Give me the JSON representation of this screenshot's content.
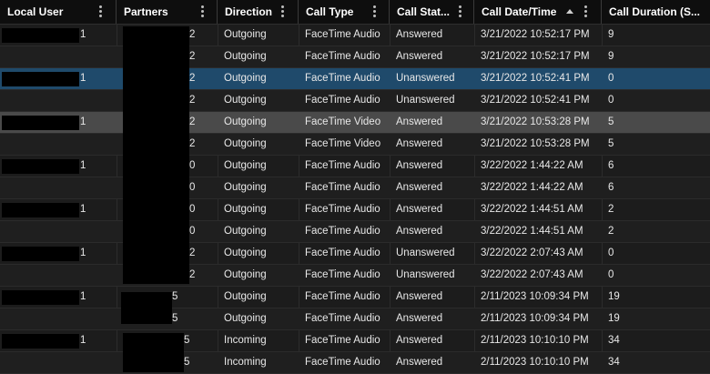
{
  "columns": [
    {
      "label": "Local User"
    },
    {
      "label": "Partners"
    },
    {
      "label": "Direction"
    },
    {
      "label": "Call Type"
    },
    {
      "label": "Call Stat..."
    },
    {
      "label": "Call Date/Time"
    },
    {
      "label": "Call Duration (S..."
    }
  ],
  "sort": {
    "column": "Call Date/Time",
    "direction": "ascending"
  },
  "colors": {
    "header_bg": "#0e0e0e",
    "row_bg": "#1c1c1c",
    "selected_row": "#1f4a6b",
    "hover_row": "#4a4a4a",
    "text": "#e8e8e8"
  },
  "rows": [
    {
      "user": "1",
      "partners": "2",
      "direction": "Outgoing",
      "type": "FaceTime Audio",
      "status": "Answered",
      "datetime": "3/21/2022 10:52:17 PM",
      "duration": "9"
    },
    {
      "user": "",
      "partners": "2",
      "direction": "Outgoing",
      "type": "FaceTime Audio",
      "status": "Answered",
      "datetime": "3/21/2022 10:52:17 PM",
      "duration": "9"
    },
    {
      "user": "1",
      "partners": "2",
      "direction": "Outgoing",
      "type": "FaceTime Audio",
      "status": "Unanswered",
      "datetime": "3/21/2022 10:52:41 PM",
      "duration": "0"
    },
    {
      "user": "",
      "partners": "2",
      "direction": "Outgoing",
      "type": "FaceTime Audio",
      "status": "Unanswered",
      "datetime": "3/21/2022 10:52:41 PM",
      "duration": "0"
    },
    {
      "user": "1",
      "partners": "2",
      "direction": "Outgoing",
      "type": "FaceTime Video",
      "status": "Answered",
      "datetime": "3/21/2022 10:53:28 PM",
      "duration": "5"
    },
    {
      "user": "",
      "partners": "2",
      "direction": "Outgoing",
      "type": "FaceTime Video",
      "status": "Answered",
      "datetime": "3/21/2022 10:53:28 PM",
      "duration": "5"
    },
    {
      "user": "1",
      "partners": "0",
      "direction": "Outgoing",
      "type": "FaceTime Audio",
      "status": "Answered",
      "datetime": "3/22/2022 1:44:22 AM",
      "duration": "6"
    },
    {
      "user": "",
      "partners": "0",
      "direction": "Outgoing",
      "type": "FaceTime Audio",
      "status": "Answered",
      "datetime": "3/22/2022 1:44:22 AM",
      "duration": "6"
    },
    {
      "user": "1",
      "partners": "0",
      "direction": "Outgoing",
      "type": "FaceTime Audio",
      "status": "Answered",
      "datetime": "3/22/2022 1:44:51 AM",
      "duration": "2"
    },
    {
      "user": "",
      "partners": "0",
      "direction": "Outgoing",
      "type": "FaceTime Audio",
      "status": "Answered",
      "datetime": "3/22/2022 1:44:51 AM",
      "duration": "2"
    },
    {
      "user": "1",
      "partners": "2",
      "direction": "Outgoing",
      "type": "FaceTime Audio",
      "status": "Unanswered",
      "datetime": "3/22/2022 2:07:43 AM",
      "duration": "0"
    },
    {
      "user": "",
      "partners": "2",
      "direction": "Outgoing",
      "type": "FaceTime Audio",
      "status": "Unanswered",
      "datetime": "3/22/2022 2:07:43 AM",
      "duration": "0"
    },
    {
      "user": "1",
      "partners": "5",
      "direction": "Outgoing",
      "type": "FaceTime Audio",
      "status": "Answered",
      "datetime": "2/11/2023 10:09:34 PM",
      "duration": "19"
    },
    {
      "user": "",
      "partners": "5",
      "direction": "Outgoing",
      "type": "FaceTime Audio",
      "status": "Answered",
      "datetime": "2/11/2023 10:09:34 PM",
      "duration": "19"
    },
    {
      "user": "1",
      "partners": "5",
      "direction": "Incoming",
      "type": "FaceTime Audio",
      "status": "Answered",
      "datetime": "2/11/2023 10:10:10 PM",
      "duration": "34"
    },
    {
      "user": "",
      "partners": "5",
      "direction": "Incoming",
      "type": "FaceTime Audio",
      "status": "Answered",
      "datetime": "2/11/2023 10:10:10 PM",
      "duration": "34"
    }
  ]
}
